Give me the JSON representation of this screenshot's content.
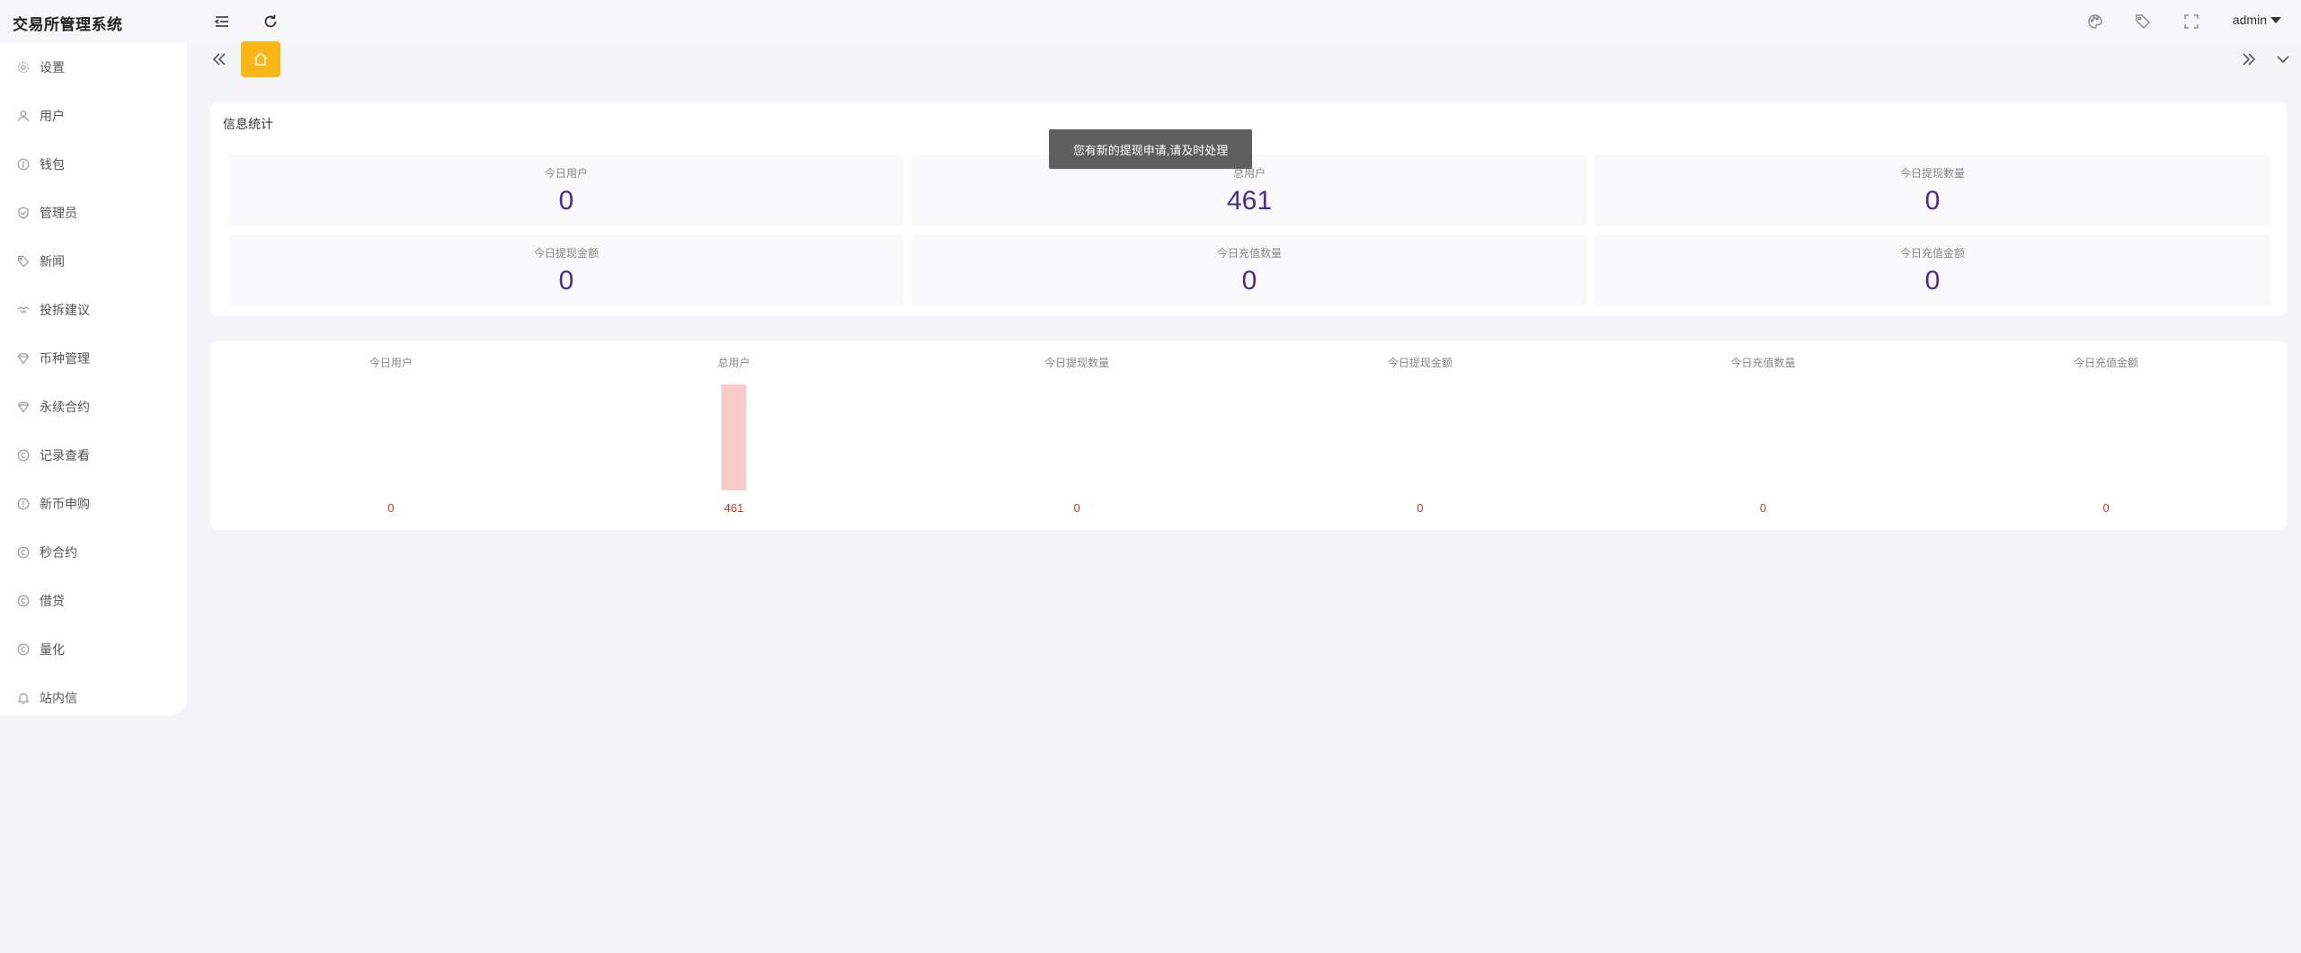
{
  "header": {
    "brand": "交易所管理系统",
    "user": "admin"
  },
  "sidebar": {
    "items": [
      {
        "label": "设置",
        "icon": "gear-icon"
      },
      {
        "label": "用户",
        "icon": "user-icon"
      },
      {
        "label": "钱包",
        "icon": "wallet-icon"
      },
      {
        "label": "管理员",
        "icon": "shield-icon"
      },
      {
        "label": "新闻",
        "icon": "tag-icon"
      },
      {
        "label": "投拆建议",
        "icon": "handshake-icon"
      },
      {
        "label": "币种管理",
        "icon": "diamond-icon"
      },
      {
        "label": "永续合约",
        "icon": "diamond-icon"
      },
      {
        "label": "记录查看",
        "icon": "copyright-icon"
      },
      {
        "label": "新币申购",
        "icon": "coin-icon"
      },
      {
        "label": "秒合约",
        "icon": "copyright-icon"
      },
      {
        "label": "借贷",
        "icon": "copyright-icon"
      },
      {
        "label": "量化",
        "icon": "copyright-icon"
      },
      {
        "label": "站内信",
        "icon": "bell-icon"
      }
    ]
  },
  "panel": {
    "title": "信息统计",
    "stats": [
      {
        "label": "今日用户",
        "value": "0"
      },
      {
        "label": "总用户",
        "value": "461"
      },
      {
        "label": "今日提现数量",
        "value": "0"
      },
      {
        "label": "今日提现金额",
        "value": "0"
      },
      {
        "label": "今日充值数量",
        "value": "0"
      },
      {
        "label": "今日充值金额",
        "value": "0"
      }
    ]
  },
  "toast": {
    "message": "您有新的提现申请,请及时处理"
  },
  "colors": {
    "accent": "#f8b619",
    "stat_value": "#4a2d8c",
    "bar_fill": "#f9caca",
    "bar_label": "#c0392b"
  },
  "chart_data": {
    "type": "bar",
    "categories": [
      "今日用户",
      "总用户",
      "今日提现数量",
      "今日提现金额",
      "今日充值数量",
      "今日充值金额"
    ],
    "values": [
      0,
      461,
      0,
      0,
      0,
      0
    ],
    "ylim": [
      0,
      461
    ],
    "grid": false,
    "data_labels": true
  }
}
